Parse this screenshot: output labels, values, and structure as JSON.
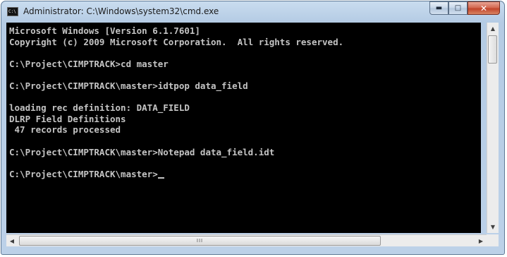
{
  "window": {
    "title": "Administrator: C:\\Windows\\system32\\cmd.exe",
    "icon_name": "cmd-icon",
    "controls": {
      "minimize_icon": "minimize-icon",
      "maximize_icon": "maximize-icon",
      "close_icon": "close-icon"
    }
  },
  "console": {
    "background": "#000000",
    "foreground": "#c0c0c0",
    "lines": [
      "Microsoft Windows [Version 6.1.7601]",
      "Copyright (c) 2009 Microsoft Corporation.  All rights reserved.",
      "",
      "C:\\Project\\CIMPTRACK>cd master",
      "",
      "C:\\Project\\CIMPTRACK\\master>idtpop data_field",
      "",
      "loading rec definition: DATA_FIELD",
      "DLRP Field Definitions",
      " 47 records processed",
      "",
      "C:\\Project\\CIMPTRACK\\master>Notepad data_field.idt",
      "",
      "C:\\Project\\CIMPTRACK\\master>"
    ]
  },
  "scrollbars": {
    "vertical": {
      "up_icon": "arrow-up-icon",
      "down_icon": "arrow-down-icon"
    },
    "horizontal": {
      "left_icon": "arrow-left-icon",
      "right_icon": "arrow-right-icon",
      "grip": "III"
    }
  }
}
